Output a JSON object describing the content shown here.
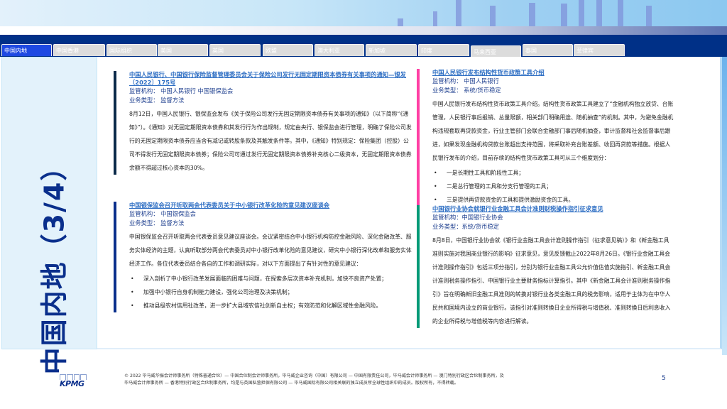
{
  "tabs": [
    {
      "label": "中国内地",
      "active": true
    },
    {
      "label": "中国香港"
    },
    {
      "label": "国际组织"
    },
    {
      "label": "美国"
    },
    {
      "label": "英国"
    },
    {
      "label": "欧盟"
    },
    {
      "label": "澳大利亚"
    },
    {
      "label": "新加坡"
    },
    {
      "label": "印度"
    },
    {
      "label": "马来西亚"
    },
    {
      "label": "泰国"
    },
    {
      "label": "菲律宾"
    }
  ],
  "page_title": "中国内地（3/4）",
  "cards": [
    {
      "title": "中国人民银行、中国银行保险监督管理委员会关于保险公司发行无固定期限资本债券有关事项的通知—银发〔2022〕175号",
      "regulator": "监管机构： 中国人民银行 中国银保监会",
      "type": "业务类型： 监督方法",
      "body": "8月12日，中国人民银行、银保监会发布《关于保险公司发行无固定期限资本债券有关事项的通知》（以下简称“《通知》”）。《通知》对无固定期限资本债券和其发行行为作出规制，规定由央行、银保监会进行管理，明确了保险公司发行的无固定期限资本债券应当含有减记或转股条款及其触发条件等。其中，《通知》特别规定：保险集团（控股）公司不得发行无固定期限资本债券；保险公司可通过发行无固定期限资本债券补充核心二级资本，无固定期限资本债券余额不得超过核心资本的30%。",
      "bullets": [],
      "color": "#0b2a4a"
    },
    {
      "title": "中国人民银行发布结构性货币政策工具介绍",
      "regulator": "监管机构： 中国人民银行",
      "type": "业务类型： 系统/货币稳定",
      "body": "中国人民银行发布结构性货币政策工具介绍。结构性货币政策工具建立了“金融机构独立放贷、台账管理，人民银行事后报销、总量限额，相关部门明确用途、随机抽查”的机制。其中，为避免金融机构违规套取再贷款资金，行业主管部门会联合金融部门事后随机抽查，审计监督和社会监督事后跟进，如果发现金融机构贷款台账超出支持范围，将采取补充台账差额、收回再贷款等措施。根据人民银行发布的介绍，目前存续的结构性货币政策工具可从三个维度划分：",
      "bullets": [
        "一是长期性工具和阶段性工具；",
        "二是总行管理的工具和分支行管理的工具；",
        "三是提供再贷款资金的工具和提供激励资金的工具。"
      ],
      "color": "#ff3fa4"
    },
    {
      "title": "中国银保监会召开听取两会代表委员关于中小银行改革化险的意见建议座谈会",
      "regulator": "监管机构： 中国银保监会",
      "type": "业务类型： 监督方法",
      "body": "中国银保监会召开听取两会代表委员意见建议座谈会。会议紧密结合中小银行机构防控金融风险、深化金融改革、服务实体经济的主题，认真听取部分两会代表委员对中小银行改革化险的意见建议，研究中小银行深化改革和服务实体经济工作。各位代表委员结合各自的工作和调研实际，对以下方面提出了有针对性的意见建议：",
      "bullets": [
        "深入剖析了中小银行改革发展面临的困难与问题，在探索多层次资本补充机制，加快不良资产处置；",
        "加强中小银行自身机制能力建设，强化公司治理及决策机制；",
        "推动县级农村信用社改革，进一步扩大县域农信社创新自主权；有效防范和化解区域性金融风险。"
      ],
      "color": "#0a2f8c"
    },
    {
      "title": "中国银行业协会就银行业金融工具会计准则财税操作指引征求意见",
      "regulator": "监管机构：中国银行业协会",
      "type": "业务类型：系统/货币稳定",
      "body": "8月8日，中国银行业协会就《银行业金融工具会计准则操作指引（征求意见稿）》和《新金融工具准则实施对我国商业银行的影响》征求意见，意见反馈截止2022年8月26日。《银行业金融工具会计准则操作指引》包括三项分指引，分别为银行业金融工具公允价值估值实施指引、新金融工具会计准则税务操作指引、中国银行业主要财务指标计算指引。其中《新金融工具会计准则税务操作指引》旨在明确新旧金融工具准则的转换对银行业各类金融工具的税务影响，适用于主体为在中华人民共和国境内设立的商业银行。该指引对准则转换日企业所得税与增值税、准则转换日后利息收入的企业所得税与增值税等内容进行解读。",
      "bullets": [],
      "color": "#009a77"
    }
  ],
  "footer": {
    "logo": "KPMG",
    "line1": "© 2022 毕马威华振会计师事务所（特殊普通合伙）— 中国合伙制会计师事务所，毕马威企业咨询（中国）有限公司 — 中国有限责任公司，毕马威会计师事务所 — 澳门特别行政区合伙制事务所，及",
    "line2": "毕马威会计师事务所 — 香港特别行政区合伙制事务所，均是与英国私营担保有限公司 — 毕马威国际有限公司相关联的独立成员所全球性组织中的成员。版权所有，不得转载。",
    "page": "5"
  }
}
